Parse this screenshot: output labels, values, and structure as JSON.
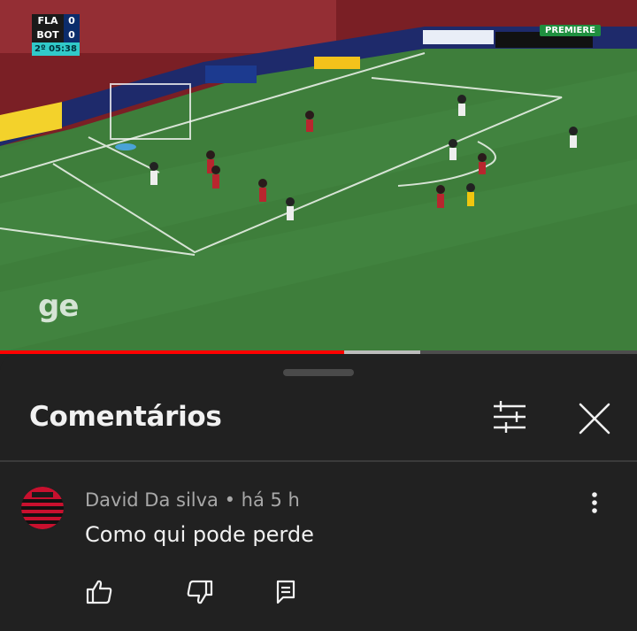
{
  "video": {
    "scoreboard": {
      "home_team": "FLA",
      "home_score": "0",
      "away_team": "BOT",
      "away_score": "0",
      "clock": "2º 05:38"
    },
    "broadcast_badge": "PREMIERE",
    "watermark": "ge",
    "progress": {
      "played_fraction": 0.54,
      "buffered_fraction": 0.66
    }
  },
  "comments_panel": {
    "title": "Comentários",
    "filter_icon": "sliders-icon",
    "close_icon": "close-icon"
  },
  "comments": [
    {
      "author": "David Da silva",
      "time": "há 5 h",
      "meta": "David Da silva • há 5 h",
      "text": "Como qui pode perde",
      "avatar": "flamengo-crest-avatar"
    }
  ],
  "colors": {
    "background": "#212121",
    "progress_played": "#ff0000",
    "text_primary": "#f1f1f1",
    "text_secondary": "#a8a8a8"
  }
}
